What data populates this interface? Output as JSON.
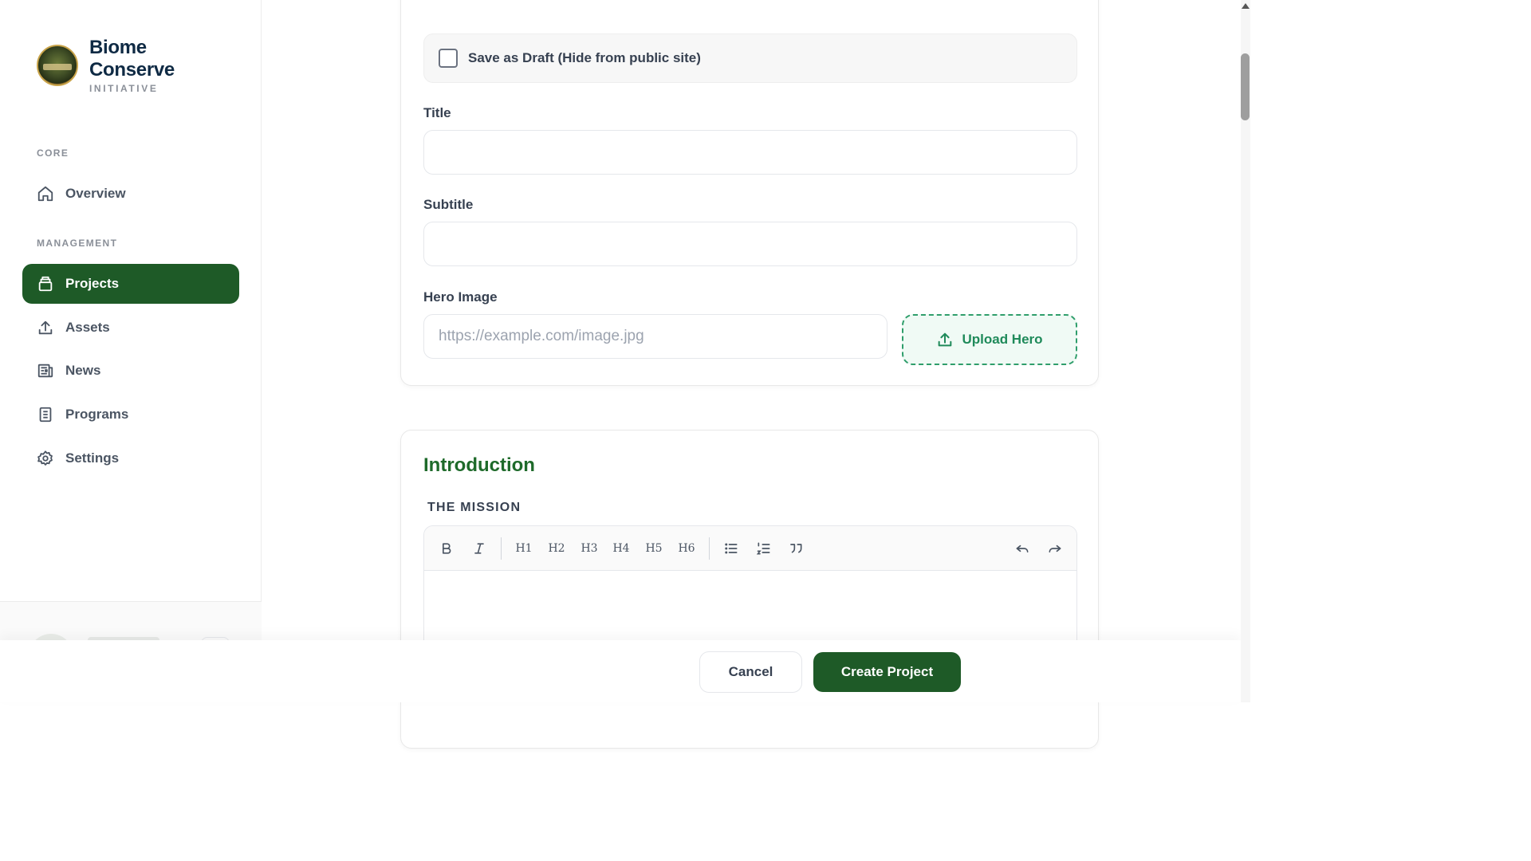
{
  "brand": {
    "name_line1": "Biome",
    "name_line2": "Conserve",
    "subtitle": "INITIATIVE"
  },
  "sidebar": {
    "sections": [
      {
        "label": "CORE"
      },
      {
        "label": "MANAGEMENT"
      }
    ],
    "items": [
      {
        "label": "Overview",
        "icon": "home-icon",
        "active": false
      },
      {
        "label": "Projects",
        "icon": "archive-icon",
        "active": true
      },
      {
        "label": "Assets",
        "icon": "upload-icon",
        "active": false
      },
      {
        "label": "News",
        "icon": "newspaper-icon",
        "active": false
      },
      {
        "label": "Programs",
        "icon": "document-icon",
        "active": false
      },
      {
        "label": "Settings",
        "icon": "gear-icon",
        "active": false
      }
    ]
  },
  "form": {
    "draft_label": "Save as Draft (Hide from public site)",
    "draft_checked": false,
    "title_label": "Title",
    "title_value": "",
    "subtitle_label": "Subtitle",
    "subtitle_value": "",
    "hero_label": "Hero Image",
    "hero_placeholder": "https://example.com/image.jpg",
    "hero_value": "",
    "upload_label": "Upload Hero"
  },
  "intro": {
    "heading": "Introduction",
    "mission_label": "THE MISSION",
    "toolbar": {
      "bold": "B",
      "italic": "I",
      "headings": [
        "H1",
        "H2",
        "H3",
        "H4",
        "H5",
        "H6"
      ],
      "bullet_list": "bullet-list-icon",
      "ordered_list": "ordered-list-icon",
      "quote": "quote-icon",
      "undo": "undo-icon",
      "redo": "redo-icon"
    }
  },
  "actions": {
    "cancel_label": "Cancel",
    "create_label": "Create Project"
  },
  "colors": {
    "accent": "#1e5a27",
    "brand_text": "#0f2a44",
    "upload_accent": "#1f8a5a",
    "heading_green": "#1e6a2a"
  }
}
